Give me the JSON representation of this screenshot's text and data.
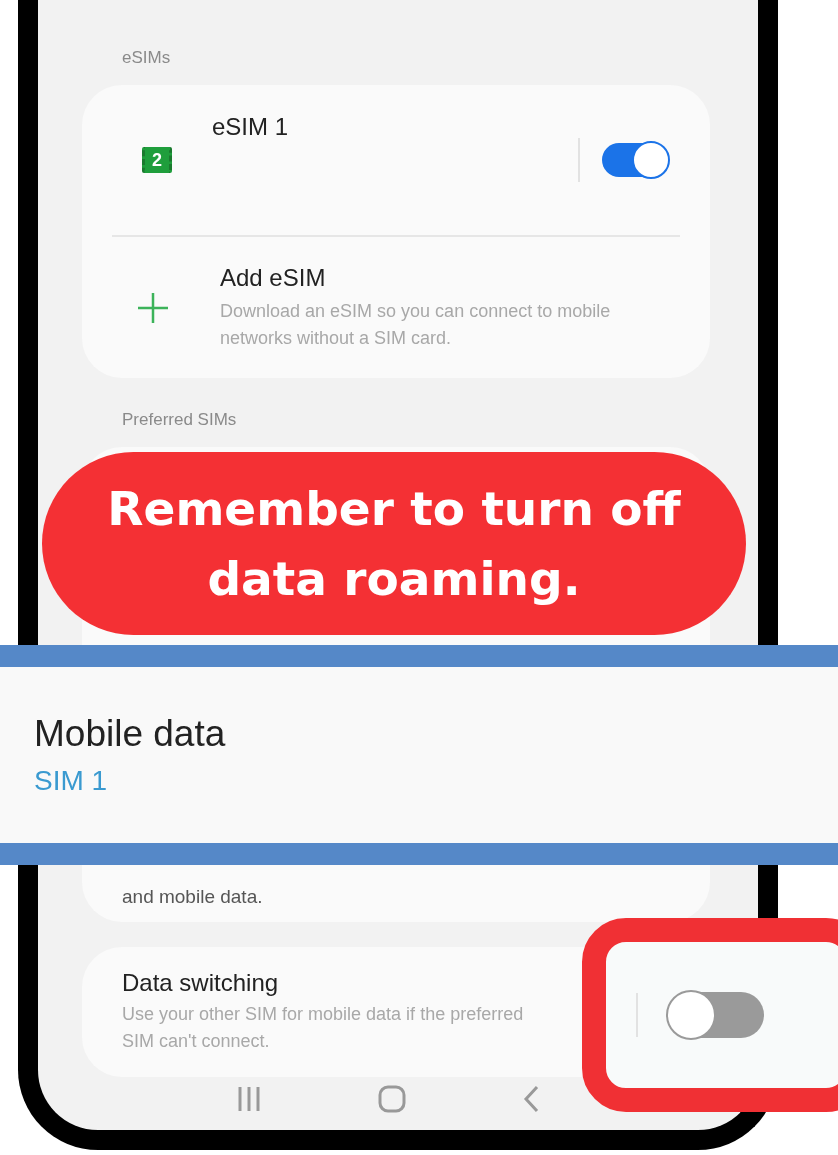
{
  "sections": [
    {
      "header": "eSIMs",
      "rows": [
        {
          "kind": "toggle",
          "badge": "2",
          "title": "eSIM 1",
          "on": true
        },
        {
          "kind": "add",
          "title": "Add eSIM",
          "description": "Download an eSIM so you can connect to mobile networks without a SIM card."
        }
      ]
    },
    {
      "header": "Preferred SIMs",
      "rows": [
        {
          "kind": "note",
          "description": "and mobile data."
        }
      ]
    }
  ],
  "data_switching": {
    "title": "Data switching",
    "description": "Use your other SIM for mobile data if the preferred SIM can't connect.",
    "on": false
  },
  "callout": {
    "text": "Remember to turn off data roaming."
  },
  "highlight": {
    "title": "Mobile data",
    "value": "SIM 1"
  }
}
